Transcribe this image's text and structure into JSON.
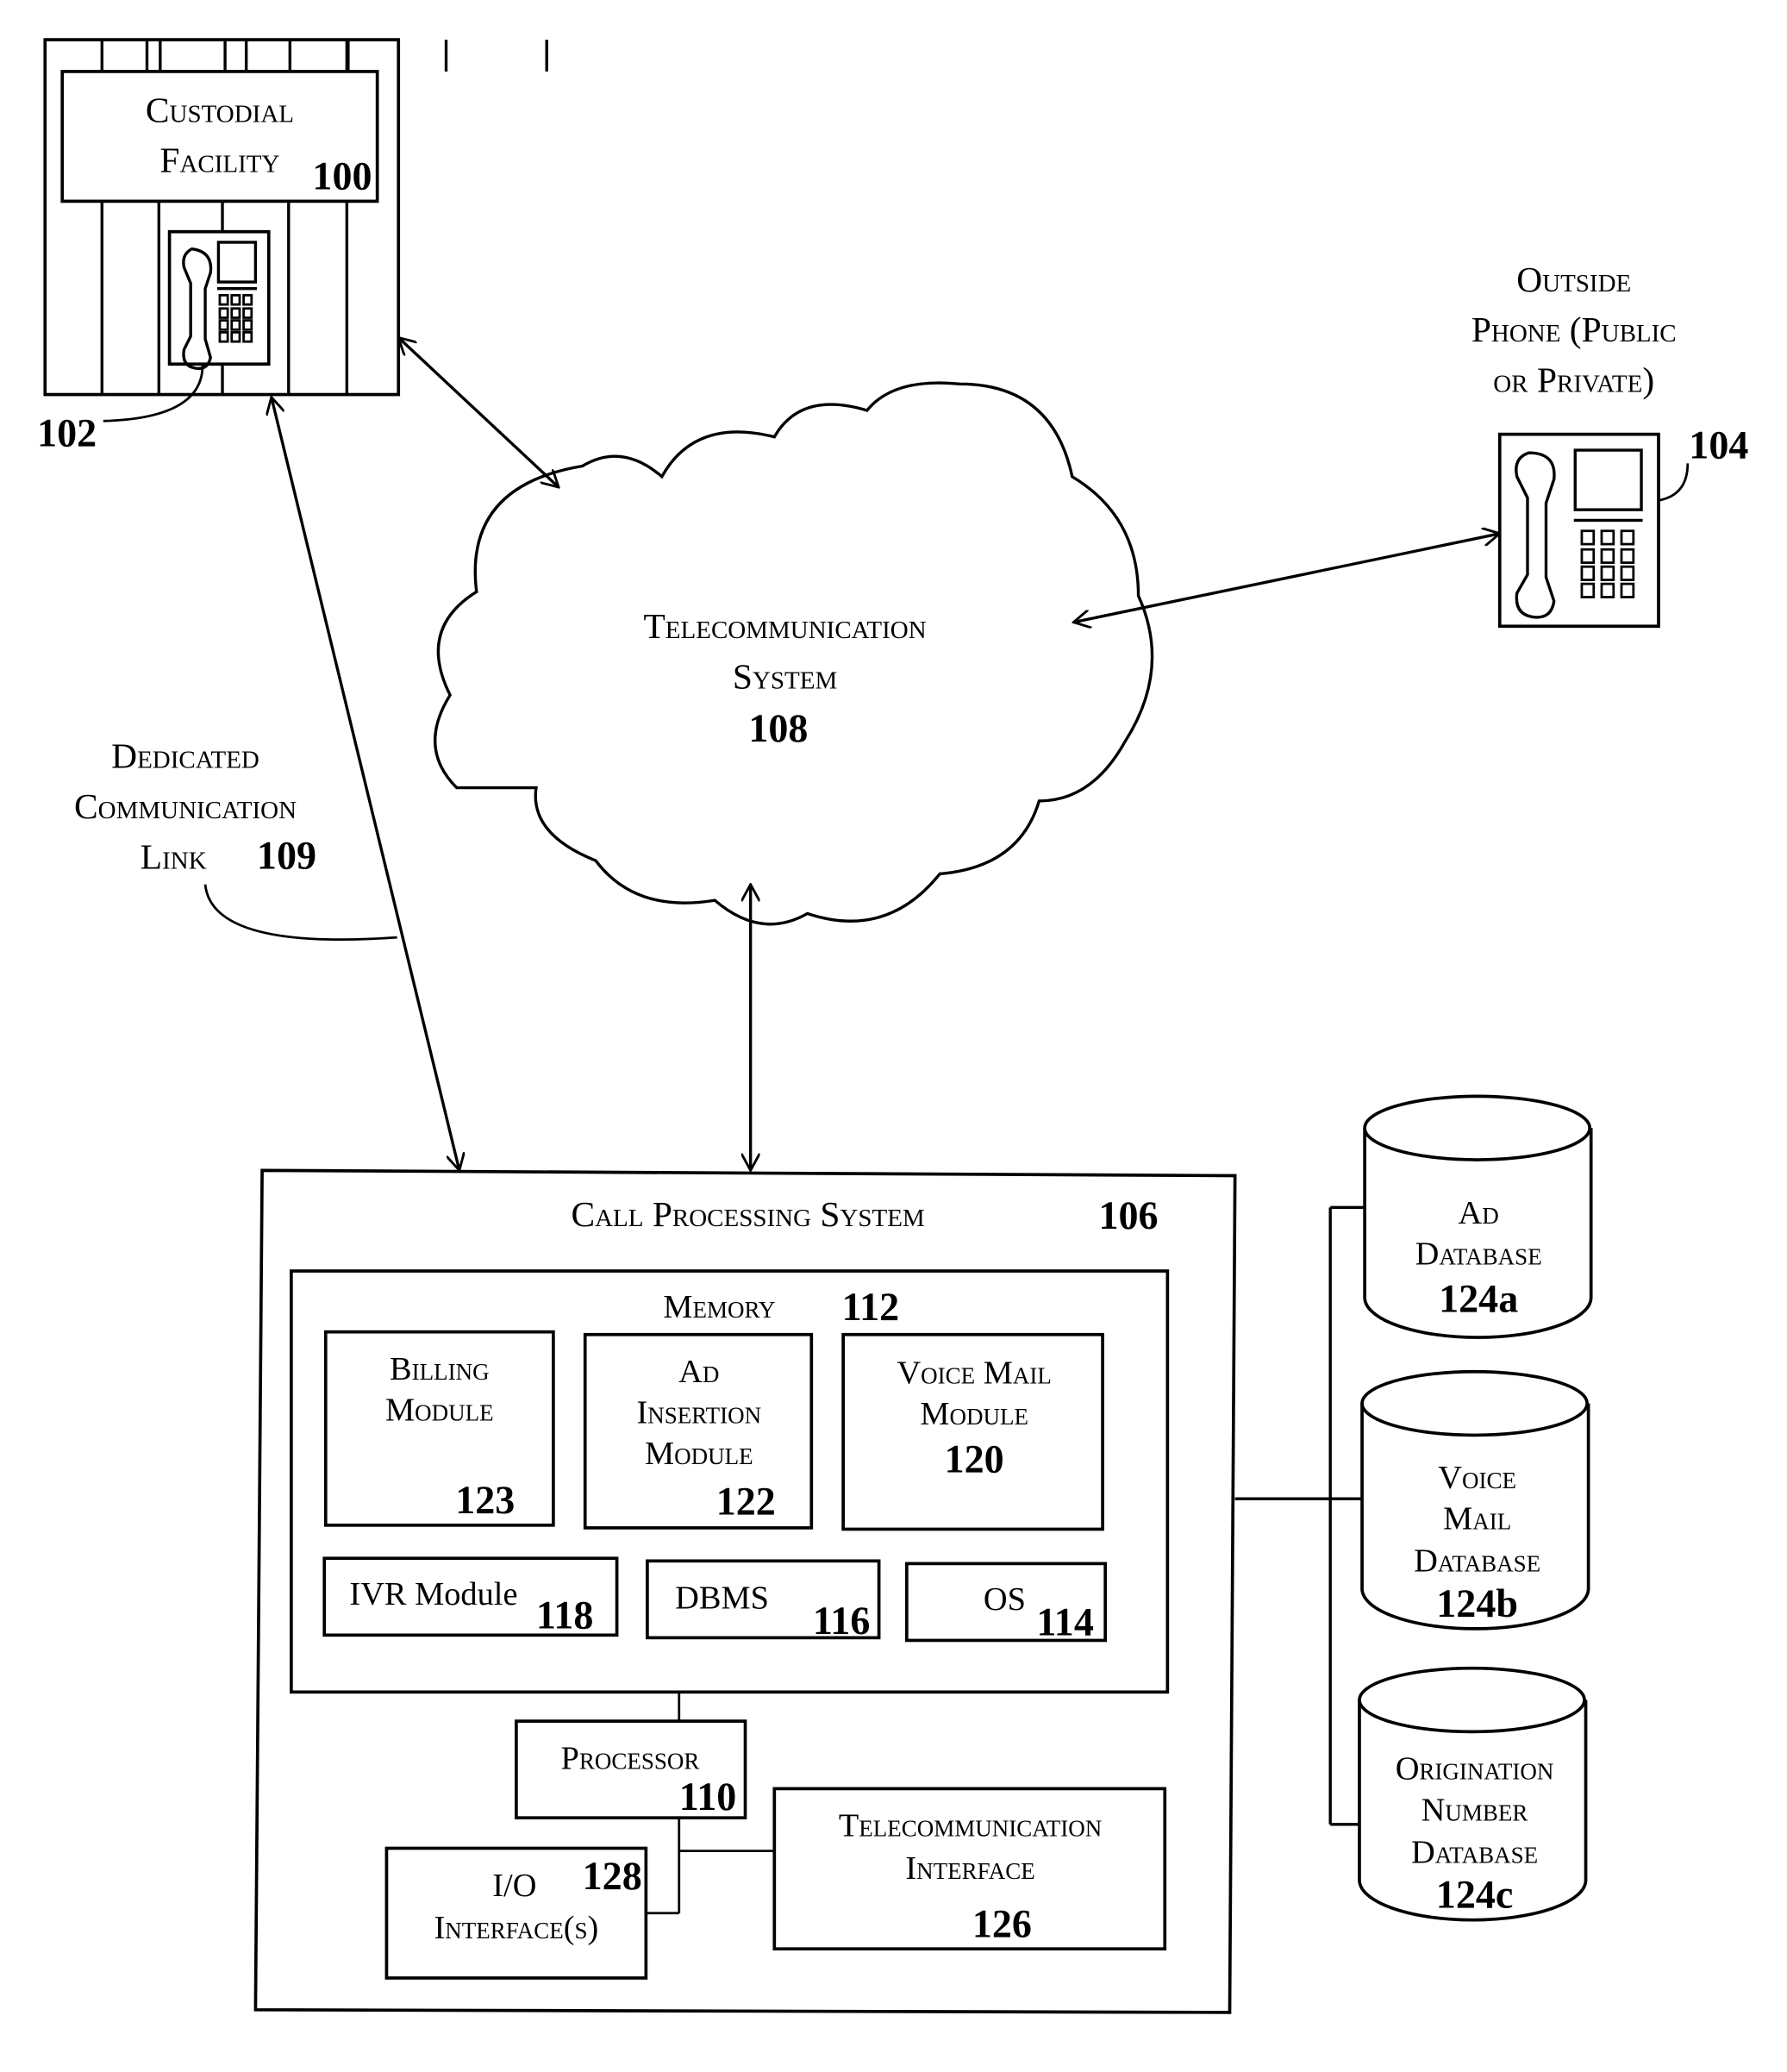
{
  "figure": {
    "custodial_facility": {
      "line1": "Custodial",
      "line2": "Facility",
      "ref": "100"
    },
    "inmate_phone": {
      "ref": "102"
    },
    "outside_phone": {
      "line1": "Outside",
      "line2": "Phone (Public",
      "line3": "or Private)",
      "ref": "104"
    },
    "telecom_system": {
      "line1": "Telecommunication",
      "line2": "System",
      "ref": "108"
    },
    "dedicated_link": {
      "line1": "Dedicated",
      "line2": "Communication",
      "line3": "Link",
      "ref": "109"
    },
    "call_processing": {
      "title": "Call Processing System",
      "ref": "106",
      "memory": {
        "title": "Memory",
        "ref": "112",
        "modules": [
          {
            "line1": "Billing",
            "line2": "Module",
            "ref": "123"
          },
          {
            "line1": "Ad",
            "line2": "Insertion",
            "line3": "Module",
            "ref": "122"
          },
          {
            "line1": "Voice Mail",
            "line2": "Module",
            "ref": "120"
          }
        ],
        "small_modules": [
          {
            "label": "IVR Module",
            "ref": "118"
          },
          {
            "label": "DBMS",
            "ref": "116"
          },
          {
            "label": "OS",
            "ref": "114"
          }
        ]
      },
      "processor": {
        "label": "Processor",
        "ref": "110"
      },
      "io_interface": {
        "line1": "I/O",
        "line2": "Interface(s)",
        "ref": "128"
      },
      "telecom_interface": {
        "line1": "Telecommunication",
        "line2": "Interface",
        "ref": "126"
      }
    },
    "databases": [
      {
        "line1": "Ad",
        "line2": "Database",
        "ref": "124a"
      },
      {
        "line1": "Voice",
        "line2": "Mail",
        "line3": "Database",
        "ref": "124b"
      },
      {
        "line1": "Origination",
        "line2": "Number",
        "line3": "Database",
        "ref": "124c"
      }
    ]
  }
}
